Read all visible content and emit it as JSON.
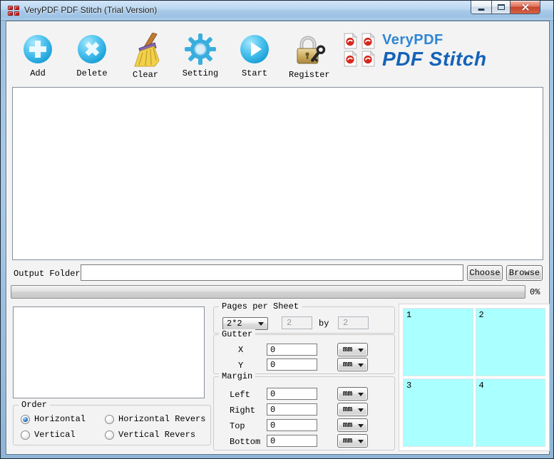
{
  "window": {
    "title": "VeryPDF PDF Stitch (Trial Version)",
    "controls": [
      {
        "name": "minimize",
        "icon": "minimize-icon"
      },
      {
        "name": "maximize",
        "icon": "maximize-icon"
      },
      {
        "name": "close",
        "icon": "close-icon"
      }
    ]
  },
  "toolbar": {
    "buttons": [
      {
        "label": "Add",
        "icon": "add-icon"
      },
      {
        "label": "Delete",
        "icon": "delete-icon"
      },
      {
        "label": "Clear",
        "icon": "broom-icon"
      },
      {
        "label": "Setting",
        "icon": "gear-icon"
      },
      {
        "label": "Start",
        "icon": "play-icon"
      },
      {
        "label": "Register",
        "icon": "lock-key-icon"
      }
    ],
    "logo": {
      "brand": "VeryPDF",
      "product": "PDF Stitch",
      "icon": "pdf-pages-logo"
    }
  },
  "file_list": {
    "items": []
  },
  "output": {
    "label": "Output Folder:",
    "value": "",
    "choose_label": "Choose",
    "browse_label": "Browse"
  },
  "progress": {
    "value": 0,
    "label": "0%"
  },
  "pages_per_sheet": {
    "legend": "Pages per Sheet",
    "layout": "2*2",
    "rows": "2",
    "by": "by",
    "cols": "2"
  },
  "gutter": {
    "legend": "Gutter",
    "rows": [
      {
        "label": "X",
        "value": "0",
        "unit": "mm"
      },
      {
        "label": "Y",
        "value": "0",
        "unit": "mm"
      }
    ]
  },
  "margin": {
    "legend": "Margin",
    "rows": [
      {
        "label": "Left",
        "value": "0",
        "unit": "mm"
      },
      {
        "label": "Right",
        "value": "0",
        "unit": "mm"
      },
      {
        "label": "Top",
        "value": "0",
        "unit": "mm"
      },
      {
        "label": "Bottom",
        "value": "0",
        "unit": "mm"
      }
    ]
  },
  "order": {
    "legend": "Order",
    "options": [
      {
        "label": "Horizontal",
        "selected": true
      },
      {
        "label": "Horizontal Revers",
        "selected": false
      },
      {
        "label": "Vertical",
        "selected": false
      },
      {
        "label": "Vertical Revers",
        "selected": false
      }
    ]
  },
  "preview": {
    "cells": [
      "1",
      "2",
      "3",
      "4"
    ],
    "cell_color": "#aaffff"
  },
  "colors": {
    "accent_blue": "#29abe2",
    "logo_blue": "#1463b8",
    "preview_cyan": "#aaffff",
    "close_red": "#c2452c",
    "titlebar_blue": "#b7d5ef",
    "gold": "#cfae62"
  }
}
